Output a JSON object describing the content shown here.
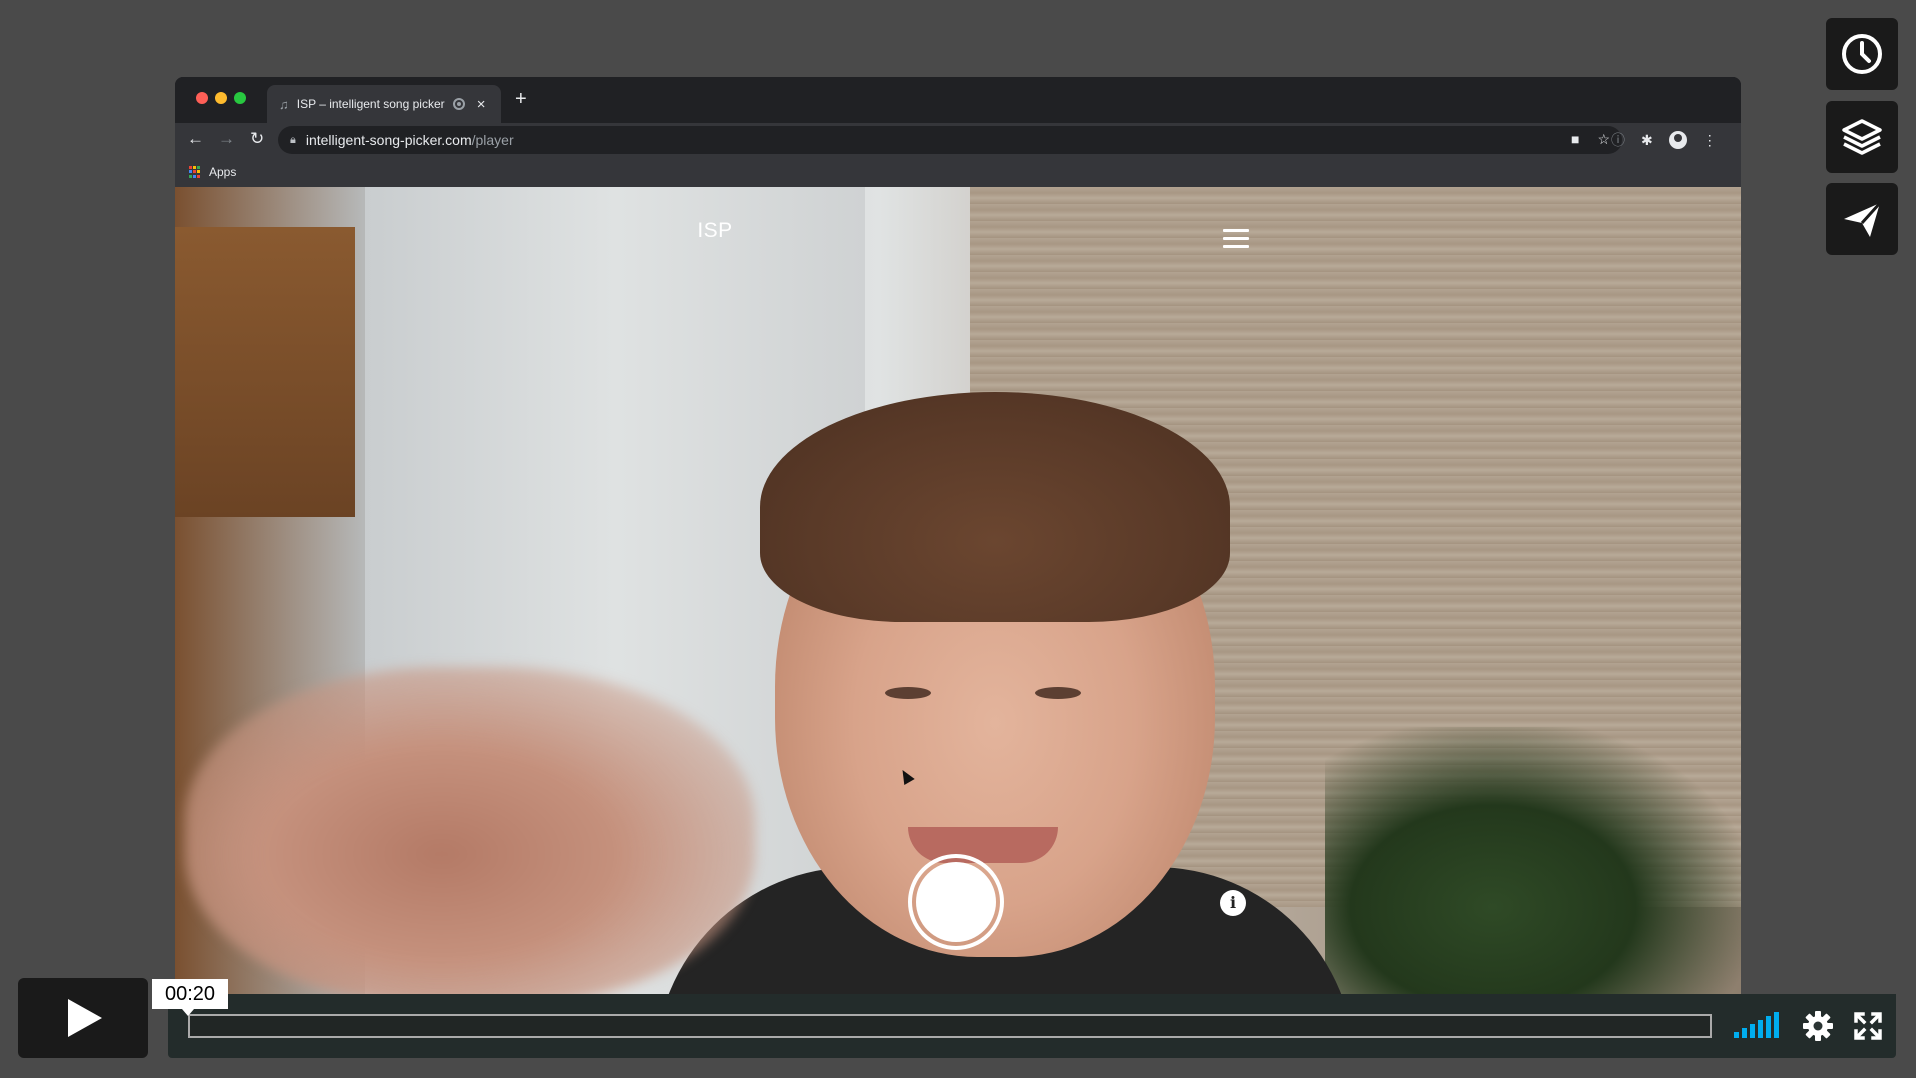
{
  "browser": {
    "tab": {
      "favicon": "music-note-icon",
      "title": "ISP – intelligent song picker",
      "close": "×"
    },
    "new_tab": "+",
    "nav": {
      "back": "←",
      "forward": "→",
      "reload": "↻"
    },
    "address": {
      "host": "intelligent-song-picker.com",
      "path": "/player"
    },
    "bookmarks": {
      "apps_label": "Apps"
    }
  },
  "app": {
    "title": "ISP",
    "menu_icon": "hamburger-menu-icon",
    "capture_icon": "shutter-button-icon",
    "info_label": "i"
  },
  "side_buttons": [
    "clock-icon",
    "layers-icon",
    "send-icon"
  ],
  "player": {
    "time": "00:20",
    "progress": 0.0,
    "accent_color": "#00adef"
  }
}
